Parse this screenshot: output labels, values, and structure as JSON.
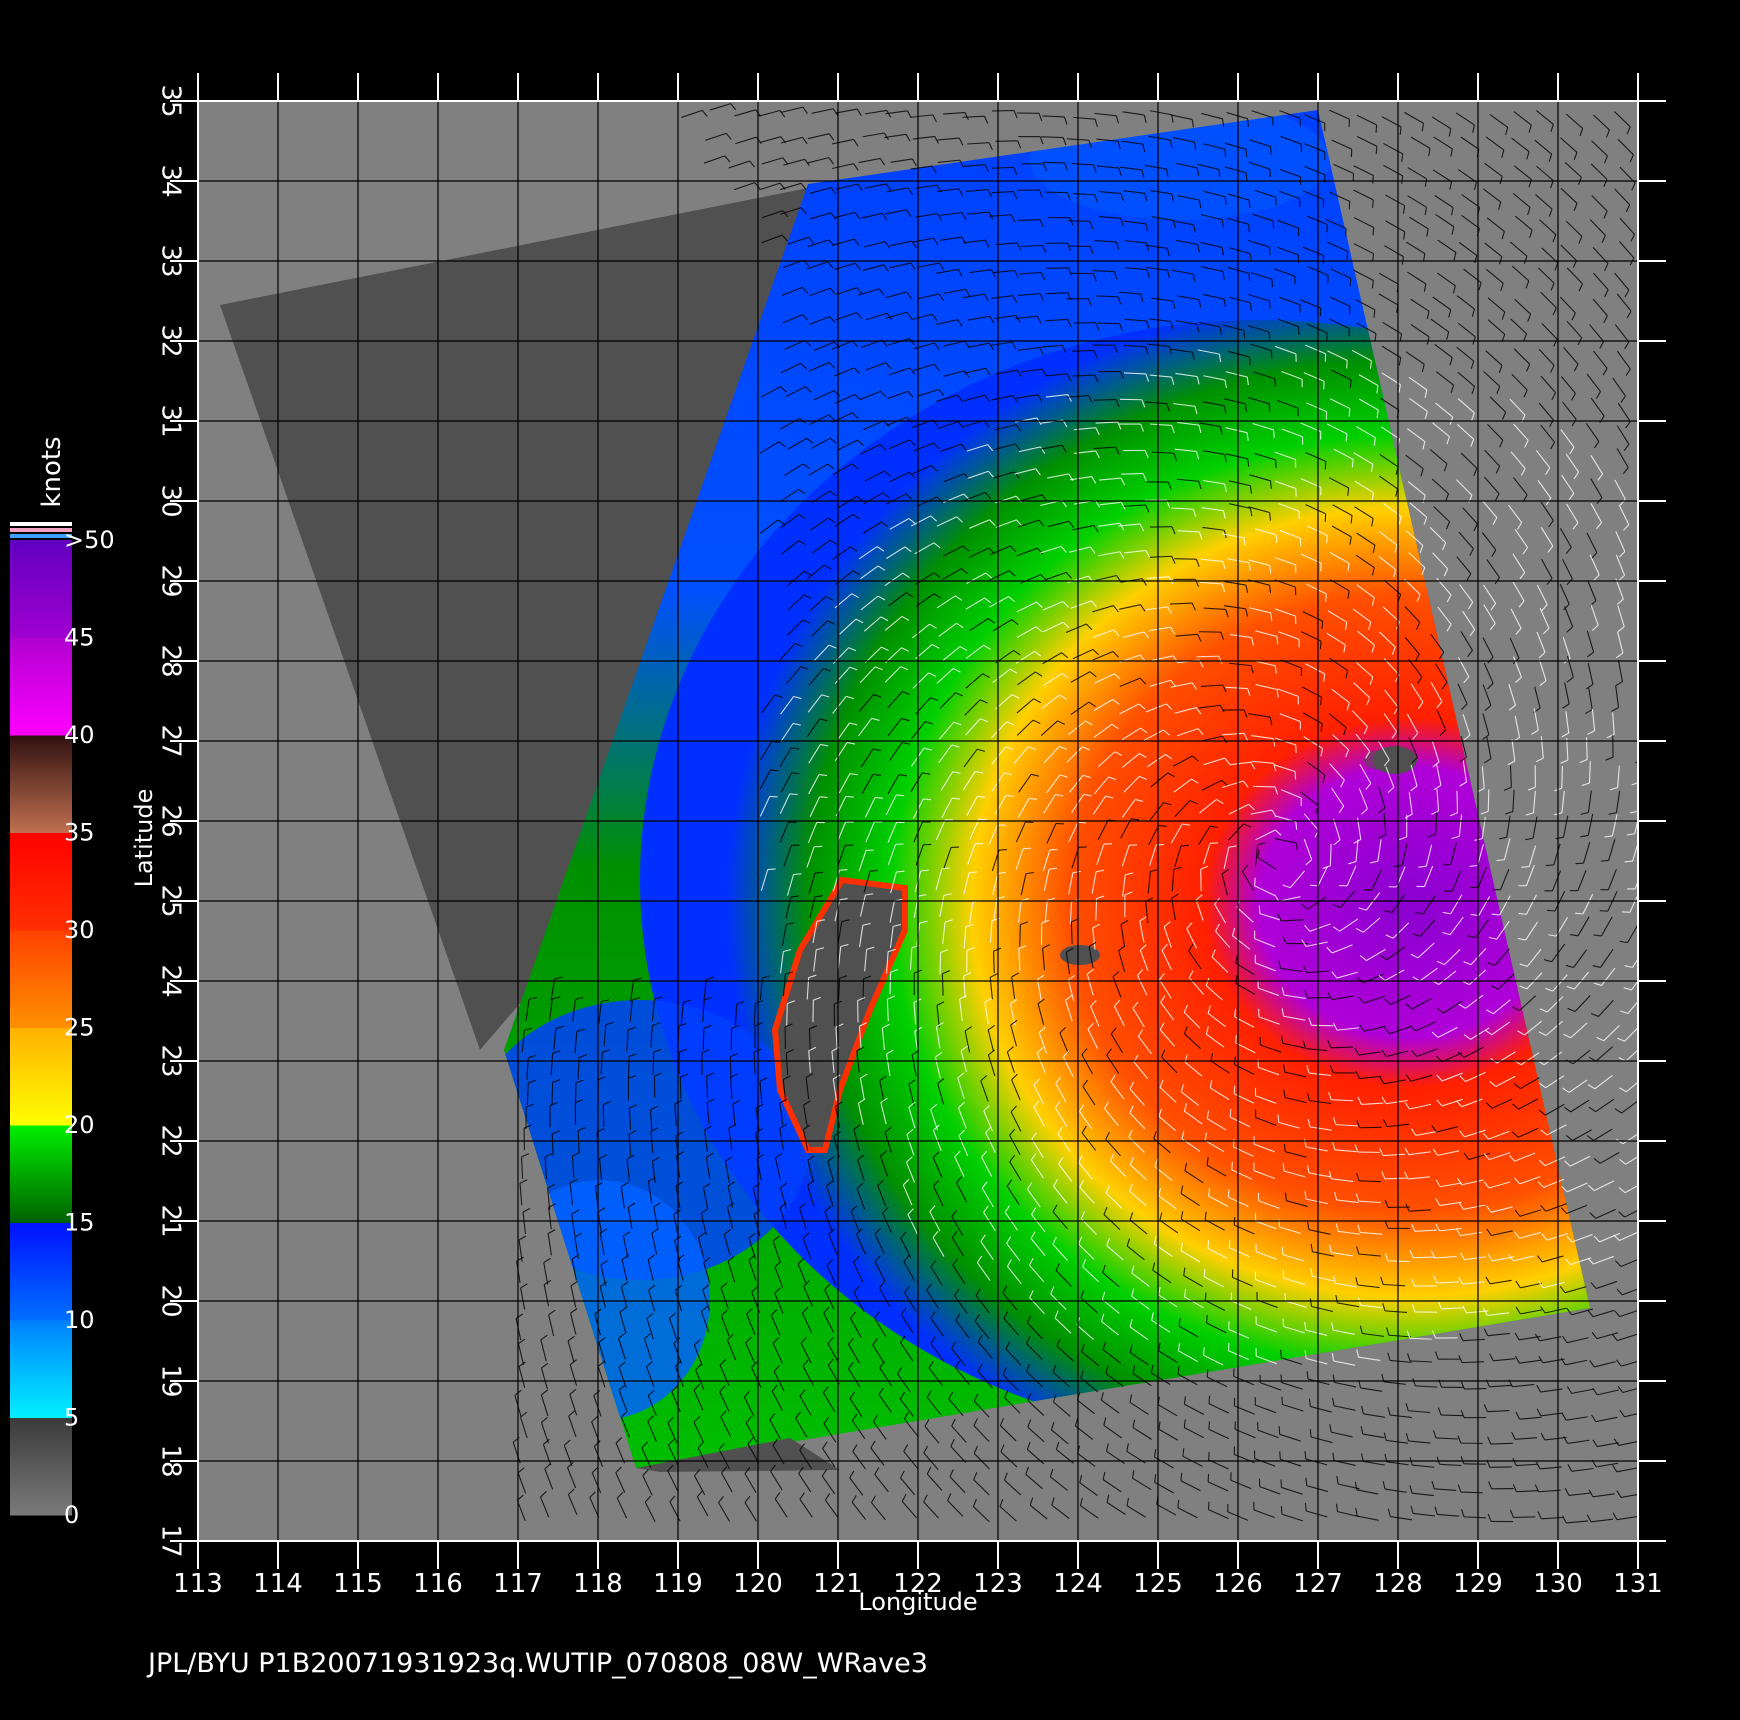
{
  "map": {
    "footer": "JPL/BYU  P1B20071931923q.WUTIP_070808_08W_WRave3",
    "xlabel": "Longitude",
    "ylabel": "Latitude",
    "lon_ticks": [
      "113",
      "114",
      "115",
      "116",
      "117",
      "118",
      "119",
      "120",
      "121",
      "122",
      "123",
      "124",
      "125",
      "126",
      "127",
      "128",
      "129",
      "130",
      "131"
    ],
    "lat_ticks": [
      "17",
      "18",
      "19",
      "20",
      "21",
      "22",
      "23",
      "24",
      "25",
      "26",
      "27",
      "28",
      "29",
      "30",
      "31",
      "32",
      "33",
      "34",
      "35"
    ],
    "lon_range": [
      113,
      131
    ],
    "lat_range": [
      17,
      35
    ],
    "grid": true,
    "land_color": "#505050",
    "background_color": "#808080"
  },
  "colorbar": {
    "title": "knots",
    "labels": [
      "0",
      "5",
      "10",
      "15",
      "20",
      "25",
      "30",
      "35",
      "40",
      "45",
      ">50"
    ],
    "stops": [
      {
        "from": 0,
        "to": 5,
        "colors": [
          "#7a7a7a",
          "#3a3a3a"
        ]
      },
      {
        "from": 5,
        "to": 10,
        "colors": [
          "#00f0ff",
          "#0080ff"
        ]
      },
      {
        "from": 10,
        "to": 15,
        "colors": [
          "#0070ff",
          "#0010ff"
        ]
      },
      {
        "from": 15,
        "to": 20,
        "colors": [
          "#006000",
          "#00f000"
        ]
      },
      {
        "from": 20,
        "to": 25,
        "colors": [
          "#ffff00",
          "#ffb000"
        ]
      },
      {
        "from": 25,
        "to": 30,
        "colors": [
          "#ff9000",
          "#ff4000"
        ]
      },
      {
        "from": 30,
        "to": 35,
        "colors": [
          "#ff3000",
          "#ff0000"
        ]
      },
      {
        "from": 35,
        "to": 40,
        "colors": [
          "#c07050",
          "#301010"
        ]
      },
      {
        "from": 40,
        "to": 45,
        "colors": [
          "#ff00ff",
          "#b000d0"
        ]
      },
      {
        "from": 45,
        "to": 50,
        "colors": [
          "#a000d0",
          "#6000c0"
        ]
      }
    ]
  }
}
